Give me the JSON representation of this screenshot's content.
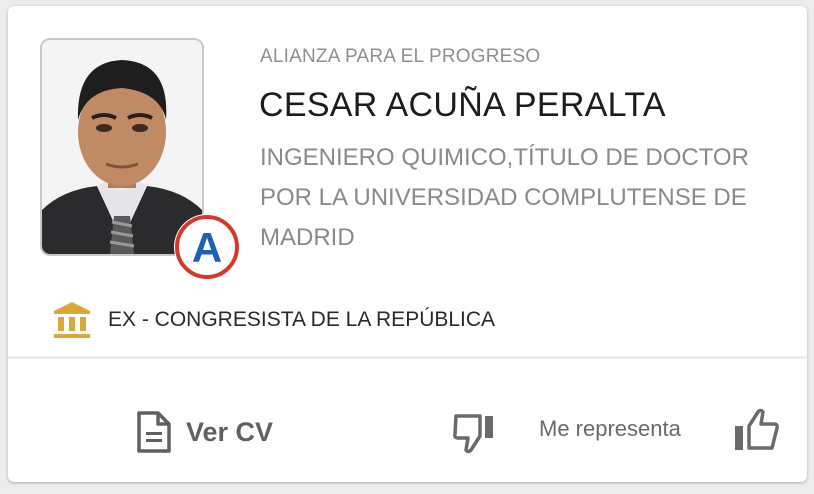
{
  "candidate": {
    "party": "ALIANZA PARA EL PROGRESO",
    "name": "CESAR ACUÑA PERALTA",
    "profession_lines": [
      "INGENIERO QUIMICO,TÍTULO DE DOCTOR",
      "POR LA UNIVERSIDAD COMPLUTENSE DE",
      "MADRID"
    ],
    "party_logo_letter": "A"
  },
  "position": {
    "icon": "government-building-icon",
    "label": "EX - CONGRESISTA DE LA REPÚBLICA"
  },
  "actions": {
    "cv_label": "Ver CV",
    "cv_icon": "document-icon",
    "dislike_icon": "thumbs-down-icon",
    "represent_label": "Me representa",
    "like_icon": "thumbs-up-icon"
  },
  "colors": {
    "accent_gold": "#d6a93a",
    "party_blue": "#1f5fb4",
    "party_red": "#d33a2f"
  }
}
